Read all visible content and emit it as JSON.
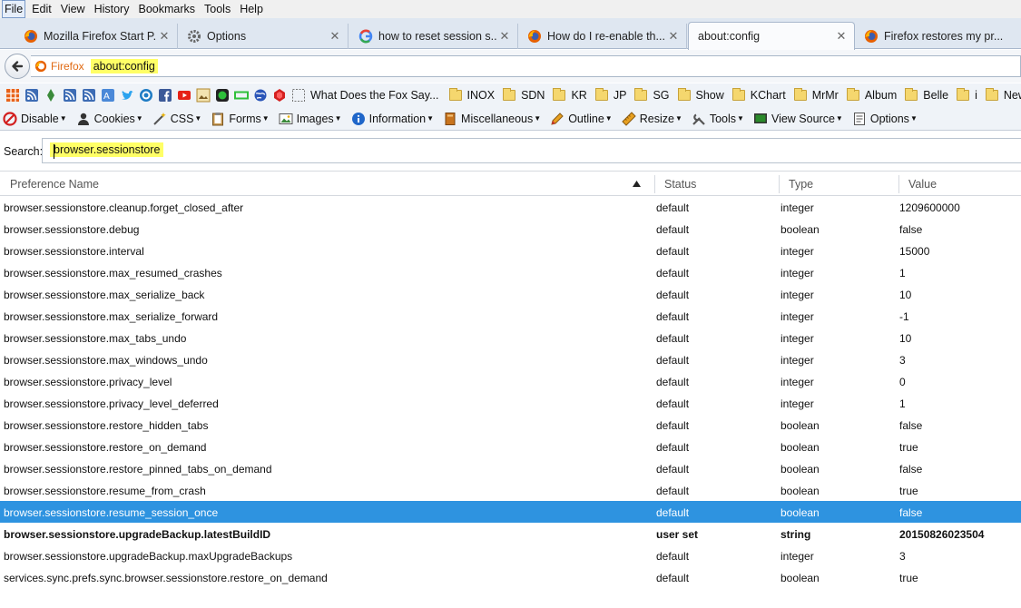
{
  "menubar": [
    "File",
    "Edit",
    "View",
    "History",
    "Bookmarks",
    "Tools",
    "Help"
  ],
  "tabs": [
    {
      "label": "Mozilla Firefox Start P...",
      "icon": "firefox-icon"
    },
    {
      "label": "Options",
      "icon": "gear-icon"
    },
    {
      "label": "how to reset session s...",
      "icon": "google-icon"
    },
    {
      "label": "How do I re-enable th...",
      "icon": "firefox-icon"
    },
    {
      "label": "about:config",
      "icon": "none",
      "active": true
    },
    {
      "label": "Firefox restores my pr...",
      "icon": "firefox-icon"
    }
  ],
  "urlbar": {
    "identity": "Firefox",
    "url": "about:config"
  },
  "bookmarks": {
    "bookmark_text": "What Does the Fox Say...",
    "folders": [
      "INOX",
      "SDN",
      "KR",
      "JP",
      "SG",
      "Show",
      "KChart",
      "MrMr",
      "Album",
      "Belle",
      "i",
      "News"
    ]
  },
  "devbar": [
    "Disable",
    "Cookies",
    "CSS",
    "Forms",
    "Images",
    "Information",
    "Miscellaneous",
    "Outline",
    "Resize",
    "Tools",
    "View Source",
    "Options"
  ],
  "search": {
    "label": "Search:",
    "value": "browser.sessionstore"
  },
  "columns": {
    "name": "Preference Name",
    "status": "Status",
    "type": "Type",
    "value": "Value"
  },
  "rows": [
    {
      "name": "browser.sessionstore.cleanup.forget_closed_after",
      "status": "default",
      "type": "integer",
      "value": "1209600000"
    },
    {
      "name": "browser.sessionstore.debug",
      "status": "default",
      "type": "boolean",
      "value": "false"
    },
    {
      "name": "browser.sessionstore.interval",
      "status": "default",
      "type": "integer",
      "value": "15000"
    },
    {
      "name": "browser.sessionstore.max_resumed_crashes",
      "status": "default",
      "type": "integer",
      "value": "1"
    },
    {
      "name": "browser.sessionstore.max_serialize_back",
      "status": "default",
      "type": "integer",
      "value": "10"
    },
    {
      "name": "browser.sessionstore.max_serialize_forward",
      "status": "default",
      "type": "integer",
      "value": "-1"
    },
    {
      "name": "browser.sessionstore.max_tabs_undo",
      "status": "default",
      "type": "integer",
      "value": "10"
    },
    {
      "name": "browser.sessionstore.max_windows_undo",
      "status": "default",
      "type": "integer",
      "value": "3"
    },
    {
      "name": "browser.sessionstore.privacy_level",
      "status": "default",
      "type": "integer",
      "value": "0"
    },
    {
      "name": "browser.sessionstore.privacy_level_deferred",
      "status": "default",
      "type": "integer",
      "value": "1"
    },
    {
      "name": "browser.sessionstore.restore_hidden_tabs",
      "status": "default",
      "type": "boolean",
      "value": "false"
    },
    {
      "name": "browser.sessionstore.restore_on_demand",
      "status": "default",
      "type": "boolean",
      "value": "true"
    },
    {
      "name": "browser.sessionstore.restore_pinned_tabs_on_demand",
      "status": "default",
      "type": "boolean",
      "value": "false"
    },
    {
      "name": "browser.sessionstore.resume_from_crash",
      "status": "default",
      "type": "boolean",
      "value": "true"
    },
    {
      "name": "browser.sessionstore.resume_session_once",
      "status": "default",
      "type": "boolean",
      "value": "false",
      "selected": true
    },
    {
      "name": "browser.sessionstore.upgradeBackup.latestBuildID",
      "status": "user set",
      "type": "string",
      "value": "20150826023504",
      "user_set": true
    },
    {
      "name": "browser.sessionstore.upgradeBackup.maxUpgradeBackups",
      "status": "default",
      "type": "integer",
      "value": "3"
    },
    {
      "name": "services.sync.prefs.sync.browser.sessionstore.restore_on_demand",
      "status": "default",
      "type": "boolean",
      "value": "true"
    }
  ],
  "colors": {
    "selection": "#2e93e0",
    "highlight": "#ffff66",
    "identity": "#e06a13"
  }
}
